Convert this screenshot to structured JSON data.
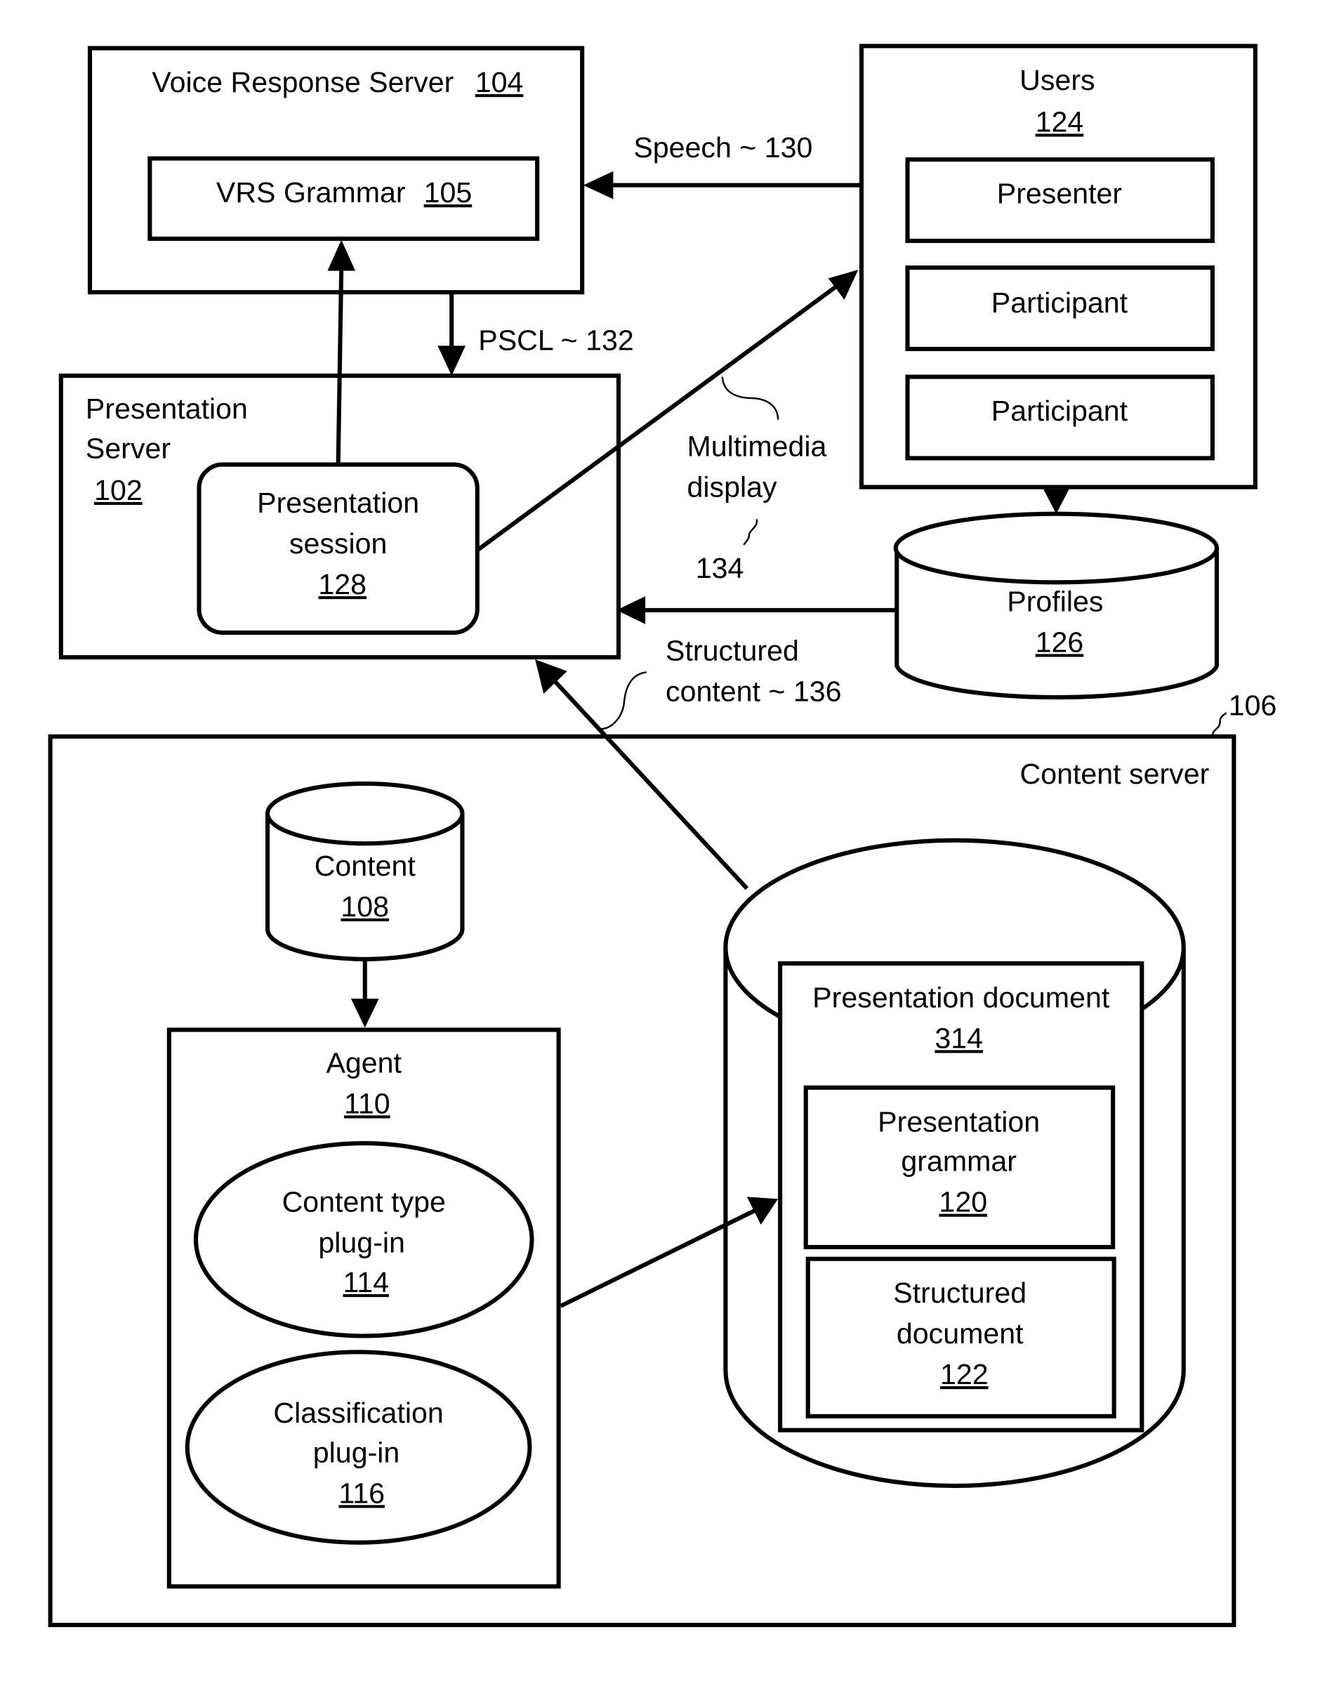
{
  "figure": {
    "voice_response_server": {
      "label": "Voice Response Server",
      "ref": "104"
    },
    "vrs_grammar": {
      "label": "VRS Grammar",
      "ref": "105"
    },
    "users": {
      "label": "Users",
      "ref": "124",
      "members": [
        "Presenter",
        "Participant",
        "Participant"
      ]
    },
    "presentation_server": {
      "line1": "Presentation",
      "line2": "Server",
      "ref": "102"
    },
    "presentation_session": {
      "line1": "Presentation",
      "line2": "session",
      "ref": "128"
    },
    "profiles": {
      "label": "Profiles",
      "ref": "126"
    },
    "content_server": {
      "label": "Content server",
      "ref": "106"
    },
    "content": {
      "label": "Content",
      "ref": "108"
    },
    "agent": {
      "label": "Agent",
      "ref": "110"
    },
    "content_type_plugin": {
      "line1": "Content type",
      "line2": "plug-in",
      "ref": "114"
    },
    "classification_plugin": {
      "line1": "Classification",
      "line2": "plug-in",
      "ref": "116"
    },
    "presentation_document": {
      "label": "Presentation document",
      "ref": "314"
    },
    "presentation_grammar": {
      "line1": "Presentation",
      "line2": "grammar",
      "ref": "120"
    },
    "structured_document": {
      "line1": "Structured",
      "line2": "document",
      "ref": "122"
    }
  },
  "connections": {
    "speech": "Speech ~ 130",
    "pscl": "PSCL ~ 132",
    "multimedia_line1": "Multimedia",
    "multimedia_line2": "display",
    "multimedia_ref": "134",
    "structured_line1": "Structured",
    "structured_line2": "content  ~ 136"
  }
}
